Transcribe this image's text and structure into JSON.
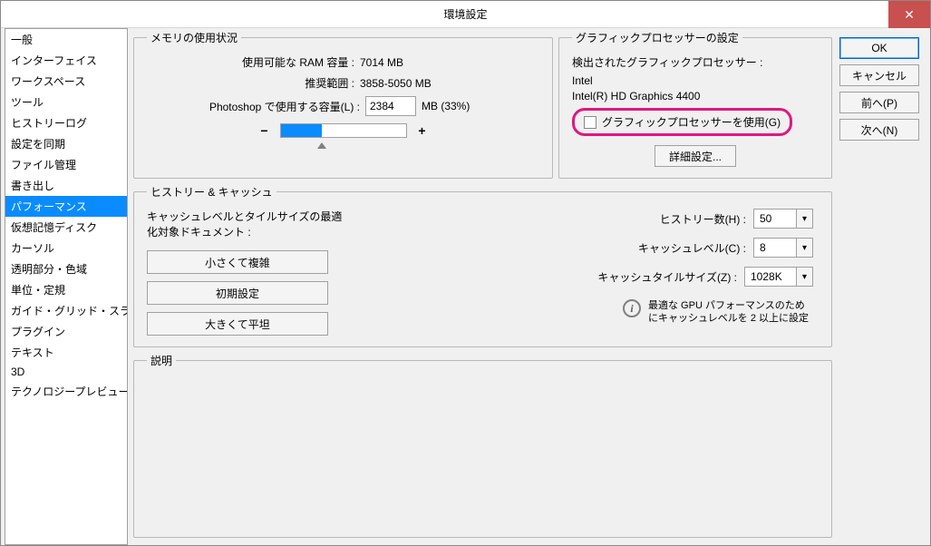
{
  "window": {
    "title": "環境設定"
  },
  "sidebar": {
    "items": [
      "一般",
      "インターフェイス",
      "ワークスペース",
      "ツール",
      "ヒストリーログ",
      "設定を同期",
      "ファイル管理",
      "書き出し",
      "パフォーマンス",
      "仮想記憶ディスク",
      "カーソル",
      "透明部分・色域",
      "単位・定規",
      "ガイド・グリッド・スライス",
      "プラグイン",
      "テキスト",
      "3D",
      "テクノロジープレビュー"
    ],
    "selected_index": 8
  },
  "memory": {
    "legend": "メモリの使用状況",
    "available_label": "使用可能な RAM 容量 :",
    "available_value": "7014 MB",
    "range_label": "推奨範囲 :",
    "range_value": "3858-5050 MB",
    "ps_use_label": "Photoshop で使用する容量(L) :",
    "ps_use_value": "2384",
    "ps_use_unit": "MB (33%)",
    "minus": "−",
    "plus": "+"
  },
  "gpu": {
    "legend": "グラフィックプロセッサーの設定",
    "detected_label": "検出されたグラフィックプロセッサー :",
    "vendor": "Intel",
    "model": "Intel(R) HD Graphics 4400",
    "use_gpu_label": "グラフィックプロセッサーを使用(G)",
    "advanced_btn": "詳細設定..."
  },
  "history": {
    "legend": "ヒストリー & キャッシュ",
    "optimize_label": "キャッシュレベルとタイルサイズの最適化対象ドキュメント :",
    "btn_small": "小さくて複雑",
    "btn_default": "初期設定",
    "btn_big": "大きくて平坦",
    "states_label": "ヒストリー数(H) :",
    "states_value": "50",
    "cache_label": "キャッシュレベル(C) :",
    "cache_value": "8",
    "tile_label": "キャッシュタイルサイズ(Z) :",
    "tile_value": "1028K",
    "note": "最適な GPU パフォーマンスのためにキャッシュレベルを 2 以上に設定"
  },
  "description": {
    "legend": "説明"
  },
  "buttons": {
    "ok": "OK",
    "cancel": "キャンセル",
    "prev": "前へ(P)",
    "next": "次へ(N)"
  }
}
